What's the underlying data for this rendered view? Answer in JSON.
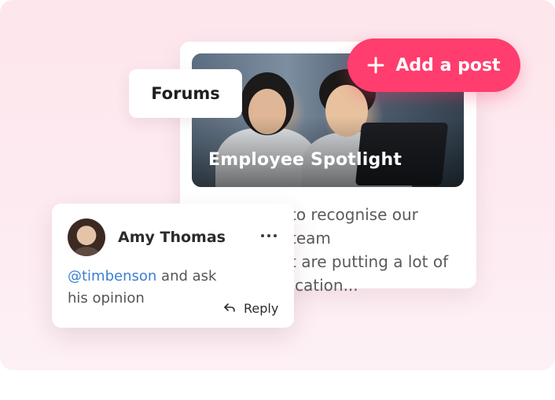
{
  "forums_tag": {
    "label": "Forums"
  },
  "add_post_button": {
    "label": "Add a post",
    "icon": "plus-icon",
    "color": "#ff3d6e"
  },
  "post_card": {
    "title": "Employee Spotlight",
    "excerpt_line1": "to recognise our team",
    "excerpt_line2": "t are putting a lot of",
    "excerpt_line3": "cation..."
  },
  "comment": {
    "author": "Amy Thomas",
    "mention": "@timbenson",
    "text_part1": " and ask",
    "text_part2": "his opinion",
    "reply_label": "Reply",
    "more_icon": "ellipsis-icon",
    "mention_color": "#3b7fd1"
  }
}
